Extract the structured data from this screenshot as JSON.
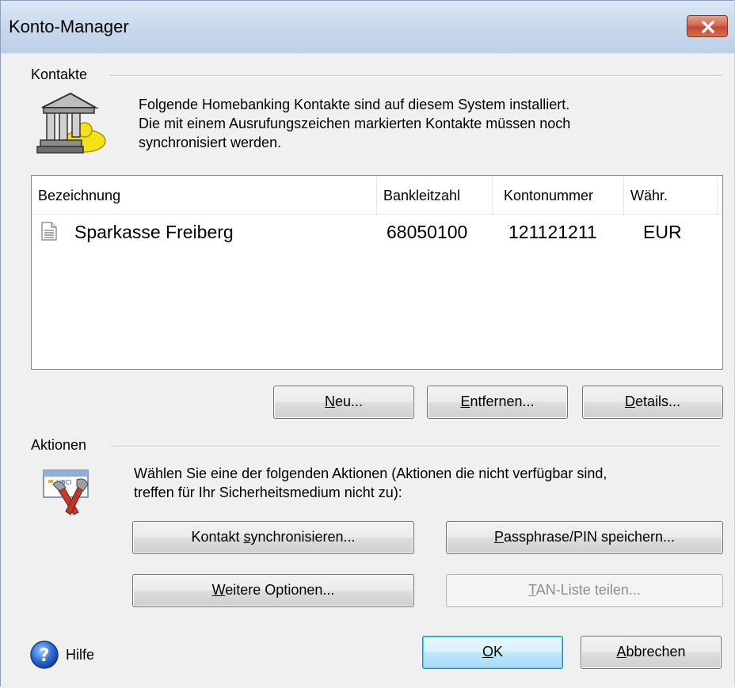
{
  "window": {
    "title": "Konto-Manager",
    "close_icon": "close-x-icon"
  },
  "contacts": {
    "group_label": "Kontakte",
    "icon": "bank-building-icon",
    "description_lines": [
      "Folgende Homebanking Kontakte sind auf diesem System installiert.",
      "Die mit einem Ausrufungszeichen markierten Kontakte müssen noch",
      "synchronisiert werden."
    ],
    "columns": [
      "Bezeichnung",
      "Bankleitzahl",
      "Kontonummer",
      "Währ."
    ],
    "rows": [
      {
        "name": "Sparkasse Freiberg",
        "blz": "68050100",
        "account": "121121211",
        "currency": "EUR",
        "icon": "document-icon"
      }
    ],
    "buttons": {
      "new": {
        "pre": "",
        "accel": "N",
        "post": "eu..."
      },
      "remove": {
        "pre": "",
        "accel": "E",
        "post": "ntfernen..."
      },
      "details": {
        "pre": "",
        "accel": "D",
        "post": "etails..."
      }
    }
  },
  "actions": {
    "group_label": "Aktionen",
    "icon": "tools-card-icon",
    "description_lines": [
      "Wählen Sie eine der folgenden Aktionen (Aktionen die nicht verfügbar sind,",
      "treffen für Ihr Sicherheitsmedium nicht zu):"
    ],
    "buttons": {
      "sync": {
        "pre": "Kontakt ",
        "accel": "s",
        "post": "ynchronisieren..."
      },
      "passphrase": {
        "pre": "",
        "accel": "P",
        "post": "assphrase/PIN speichern..."
      },
      "more": {
        "pre": "",
        "accel": "W",
        "post": "eitere Optionen..."
      },
      "tan": {
        "pre": "",
        "accel": "T",
        "post": "AN-Liste teilen..."
      }
    }
  },
  "footer": {
    "help_label": "Hilfe",
    "help_icon": "help-question-icon",
    "ok": {
      "pre": "",
      "accel": "O",
      "post": "K"
    },
    "cancel": {
      "pre": "",
      "accel": "A",
      "post": "bbrechen"
    }
  }
}
